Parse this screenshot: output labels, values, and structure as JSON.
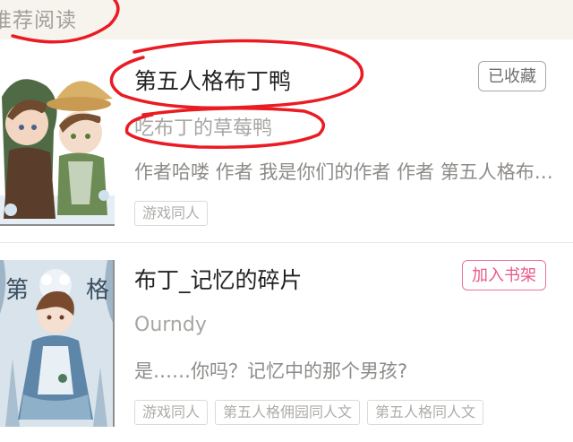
{
  "section": {
    "title": "推荐阅读"
  },
  "books": [
    {
      "title": "第五人格布丁鸭",
      "author": "吃布丁的草莓鸭",
      "description": "作者哈喽 作者 我是你们的作者 作者 第五人格布丁鸭",
      "tags": [
        "游戏同人"
      ],
      "action_label": "已收藏",
      "cover_icon": "anime-couple-cover"
    },
    {
      "title": "布丁_记忆的碎片",
      "author": "Ourndy",
      "description": "是……你吗？记忆中的那个男孩?",
      "tags": [
        "游戏同人",
        "第五人格佣园同人文",
        "第五人格同人文"
      ],
      "action_label": "加入书架",
      "cover_icon": "anime-girl-cover",
      "cover_text": "第 格"
    }
  ],
  "colors": {
    "header_bg": "#f7f4ee",
    "annotation_red": "#ea1b23",
    "add_button": "#e8588a"
  }
}
